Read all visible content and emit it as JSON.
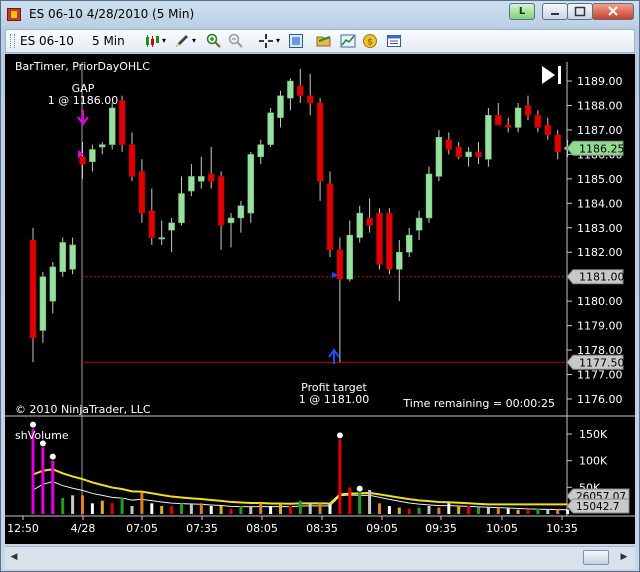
{
  "window": {
    "title": "ES 06-10  4/28/2010 (5 Min)",
    "link_button": "L"
  },
  "toolbar": {
    "instrument": "ES 06-10",
    "interval": "5 Min"
  },
  "chart": {
    "indicator_label": "BarTimer, PriorDayOHLC",
    "gap_label": "GAP",
    "gap_order": "1 @ 1186.00",
    "profit_label": "Profit target",
    "profit_order": "1 @ 1181.00",
    "copyright": "© 2010 NinjaTrader, LLC",
    "time_remaining": "Time remaining = 00:00:25",
    "volume_label": "shVolume",
    "colors": {
      "up": "#98e0a0",
      "down": "#e00000",
      "grid": "#c8c8c8",
      "price_line": "#c00000",
      "marker": "#e000e0"
    }
  },
  "chart_data": {
    "type": "candlestick",
    "price_axis": {
      "ticks": [
        "1189.00",
        "1188.00",
        "1187.00",
        "1186.00",
        "1185.00",
        "1184.00",
        "1183.00",
        "1182.00",
        "1181.00",
        "1180.00",
        "1179.00",
        "1178.00",
        "1177.00",
        "1176.00"
      ],
      "range": [
        1175.6,
        1189.7
      ]
    },
    "price_markers": [
      "1186.25",
      "1181.00",
      "1177.50"
    ],
    "x_ticks": [
      "12:50",
      "4/28",
      "07:05",
      "07:35",
      "08:05",
      "08:35",
      "09:05",
      "09:35",
      "10:05",
      "10:35"
    ],
    "volume_axis": {
      "ticks": [
        "150K",
        "100K",
        "50K"
      ],
      "range": [
        0,
        165000
      ]
    },
    "volume_markers": [
      "26057.07",
      "15042.7"
    ],
    "candles": [
      {
        "o": 1182.5,
        "h": 1183,
        "l": 1177.5,
        "c": 1178.5
      },
      {
        "o": 1178.8,
        "h": 1181.2,
        "l": 1178.3,
        "c": 1181
      },
      {
        "o": 1180,
        "h": 1181.6,
        "l": 1179.5,
        "c": 1181.4
      },
      {
        "o": 1181.2,
        "h": 1182.6,
        "l": 1181,
        "c": 1182.4
      },
      {
        "o": 1181.3,
        "h": 1182.6,
        "l": 1181.1,
        "c": 1182.3
      },
      {
        "o": 1185.9,
        "h": 1186.5,
        "l": 1185,
        "c": 1185.6
      },
      {
        "o": 1185.7,
        "h": 1186.4,
        "l": 1185.3,
        "c": 1186.2
      },
      {
        "o": 1186.3,
        "h": 1186.5,
        "l": 1186,
        "c": 1186.4
      },
      {
        "o": 1186.4,
        "h": 1188.1,
        "l": 1186.2,
        "c": 1187.9
      },
      {
        "o": 1188.2,
        "h": 1188.4,
        "l": 1186.1,
        "c": 1186.4
      },
      {
        "o": 1186.4,
        "h": 1186.9,
        "l": 1184.9,
        "c": 1185.1
      },
      {
        "o": 1185.3,
        "h": 1185.8,
        "l": 1183.2,
        "c": 1183.6
      },
      {
        "o": 1183.7,
        "h": 1184.6,
        "l": 1182.3,
        "c": 1182.6
      },
      {
        "o": 1182.6,
        "h": 1183.3,
        "l": 1182.3,
        "c": 1182.6
      },
      {
        "o": 1182.9,
        "h": 1183.4,
        "l": 1182,
        "c": 1183.2
      },
      {
        "o": 1183.2,
        "h": 1185.1,
        "l": 1183.1,
        "c": 1184.4
      },
      {
        "o": 1184.5,
        "h": 1185.6,
        "l": 1184.3,
        "c": 1185.1
      },
      {
        "o": 1184.9,
        "h": 1185.9,
        "l": 1184.6,
        "c": 1185.1
      },
      {
        "o": 1185.2,
        "h": 1186.3,
        "l": 1184.6,
        "c": 1184.9
      },
      {
        "o": 1185.1,
        "h": 1185.3,
        "l": 1182.1,
        "c": 1183.1
      },
      {
        "o": 1183.2,
        "h": 1183.6,
        "l": 1182.2,
        "c": 1183.4
      },
      {
        "o": 1183.4,
        "h": 1184.1,
        "l": 1182.8,
        "c": 1183.9
      },
      {
        "o": 1183.6,
        "h": 1186.1,
        "l": 1183.2,
        "c": 1186
      },
      {
        "o": 1185.9,
        "h": 1186.6,
        "l": 1185.6,
        "c": 1186.4
      },
      {
        "o": 1186.4,
        "h": 1187.9,
        "l": 1186.3,
        "c": 1187.7
      },
      {
        "o": 1187.5,
        "h": 1188.6,
        "l": 1187.1,
        "c": 1188.4
      },
      {
        "o": 1188.3,
        "h": 1189.1,
        "l": 1187.8,
        "c": 1189
      },
      {
        "o": 1188.8,
        "h": 1189.5,
        "l": 1188.1,
        "c": 1188.4
      },
      {
        "o": 1188.4,
        "h": 1189.3,
        "l": 1187.6,
        "c": 1188.1
      },
      {
        "o": 1188.1,
        "h": 1188.3,
        "l": 1184.1,
        "c": 1184.9
      },
      {
        "o": 1184.8,
        "h": 1185.3,
        "l": 1181.8,
        "c": 1182.1
      },
      {
        "o": 1182.1,
        "h": 1182.6,
        "l": 1177.5,
        "c": 1180.9
      },
      {
        "o": 1180.9,
        "h": 1183.3,
        "l": 1180.8,
        "c": 1182.7
      },
      {
        "o": 1182.6,
        "h": 1183.9,
        "l": 1182.4,
        "c": 1183.6
      },
      {
        "o": 1183.4,
        "h": 1184.2,
        "l": 1182.8,
        "c": 1183.1
      },
      {
        "o": 1183.6,
        "h": 1183.8,
        "l": 1181.3,
        "c": 1181.5
      },
      {
        "o": 1183.6,
        "h": 1183.8,
        "l": 1181.1,
        "c": 1181.3
      },
      {
        "o": 1181.3,
        "h": 1182.5,
        "l": 1180,
        "c": 1182
      },
      {
        "o": 1182,
        "h": 1183,
        "l": 1181.8,
        "c": 1182.7
      },
      {
        "o": 1182.9,
        "h": 1183.7,
        "l": 1182.5,
        "c": 1183.4
      },
      {
        "o": 1183.4,
        "h": 1185.5,
        "l": 1183.2,
        "c": 1185.2
      },
      {
        "o": 1185.1,
        "h": 1187,
        "l": 1184.9,
        "c": 1186.7
      },
      {
        "o": 1186.6,
        "h": 1186.9,
        "l": 1186,
        "c": 1186.2
      },
      {
        "o": 1186.3,
        "h": 1186.5,
        "l": 1185.8,
        "c": 1185.9
      },
      {
        "o": 1185.9,
        "h": 1186.3,
        "l": 1185.5,
        "c": 1186.1
      },
      {
        "o": 1186.1,
        "h": 1186.5,
        "l": 1185.6,
        "c": 1185.9
      },
      {
        "o": 1185.8,
        "h": 1187.9,
        "l": 1185.5,
        "c": 1187.6
      },
      {
        "o": 1187.6,
        "h": 1188.1,
        "l": 1187.3,
        "c": 1187.2
      },
      {
        "o": 1187.2,
        "h": 1187.5,
        "l": 1186.9,
        "c": 1187.1
      },
      {
        "o": 1187.1,
        "h": 1188.1,
        "l": 1186.9,
        "c": 1187.9
      },
      {
        "o": 1188,
        "h": 1188.4,
        "l": 1187.4,
        "c": 1187.6
      },
      {
        "o": 1187.6,
        "h": 1187.8,
        "l": 1186.9,
        "c": 1187.1
      },
      {
        "o": 1187.2,
        "h": 1187.5,
        "l": 1186.6,
        "c": 1186.8
      },
      {
        "o": 1186.8,
        "h": 1187,
        "l": 1185.8,
        "c": 1186.1
      },
      {
        "o": 1186.2,
        "h": 1186.6,
        "l": 1185.9,
        "c": 1186.3
      }
    ],
    "volume": [
      160000,
      125000,
      100000,
      30000,
      35000,
      35000,
      20000,
      25000,
      20000,
      30000,
      15000,
      40000,
      20000,
      15000,
      15000,
      20000,
      20000,
      20000,
      15000,
      15000,
      10000,
      15000,
      15000,
      20000,
      15000,
      20000,
      15000,
      25000,
      20000,
      20000,
      18000,
      140000,
      50000,
      40000,
      45000,
      20000,
      15000,
      12000,
      10000,
      12000,
      15000,
      12000,
      20000,
      15000,
      15000,
      12000,
      12000,
      12000,
      10000,
      8000,
      8000,
      10000,
      8000,
      8000,
      8000
    ]
  }
}
